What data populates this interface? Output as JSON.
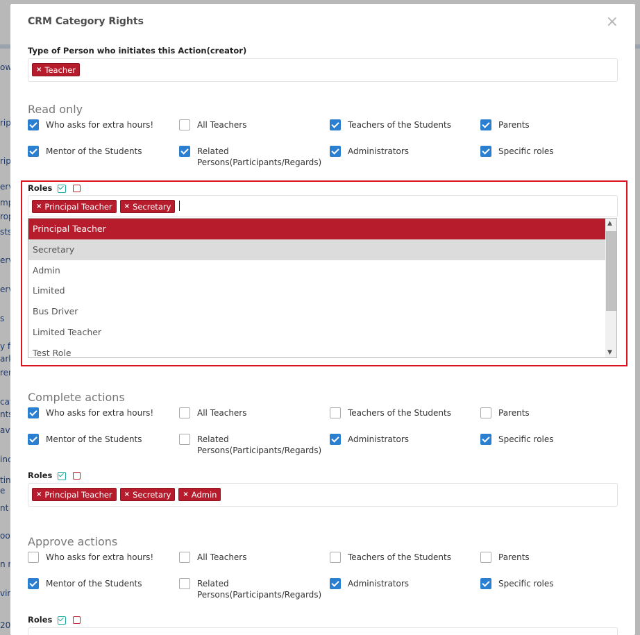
{
  "background": {
    "fragments": [
      "own",
      "rip",
      "ripi",
      "ervic",
      "mple",
      "ropo",
      "sts",
      "erv",
      "erv",
      "s",
      "y fr",
      "ark",
      "ren",
      "cat",
      "nts",
      "avio",
      "inci",
      "tin",
      "e",
      "nt",
      "ool",
      "n re",
      "ving",
      "20"
    ]
  },
  "modal": {
    "title": "CRM Category Rights",
    "close_glyph": "×",
    "creator_label": "Type of Person who initiates this Action(creator)",
    "creator_tags": [
      "Teacher"
    ]
  },
  "sections": [
    {
      "title": "Read only",
      "options": [
        {
          "label": "Who asks for extra hours!",
          "checked": true
        },
        {
          "label": "All Teachers",
          "checked": false
        },
        {
          "label": "Teachers of the Students",
          "checked": true
        },
        {
          "label": "Parents",
          "checked": true
        },
        {
          "label": "Mentor of the Students",
          "checked": true
        },
        {
          "label": "Related Persons(Participants/Regards)",
          "checked": true
        },
        {
          "label": "Administrators",
          "checked": true
        },
        {
          "label": "Specific roles",
          "checked": true
        }
      ],
      "roles_label": "Roles",
      "roles": [
        "Principal Teacher",
        "Secretary"
      ]
    },
    {
      "title": "Complete actions",
      "options": [
        {
          "label": "Who asks for extra hours!",
          "checked": true
        },
        {
          "label": "All Teachers",
          "checked": false
        },
        {
          "label": "Teachers of the Students",
          "checked": false
        },
        {
          "label": "Parents",
          "checked": false
        },
        {
          "label": "Mentor of the Students",
          "checked": true
        },
        {
          "label": "Related Persons(Participants/Regards)",
          "checked": false
        },
        {
          "label": "Administrators",
          "checked": true
        },
        {
          "label": "Specific roles",
          "checked": true
        }
      ],
      "roles_label": "Roles",
      "roles": [
        "Principal Teacher",
        "Secretary",
        "Admin"
      ]
    },
    {
      "title": "Approve actions",
      "options": [
        {
          "label": "Who asks for extra hours!",
          "checked": false
        },
        {
          "label": "All Teachers",
          "checked": false
        },
        {
          "label": "Teachers of the Students",
          "checked": false
        },
        {
          "label": "Parents",
          "checked": false
        },
        {
          "label": "Mentor of the Students",
          "checked": true
        },
        {
          "label": "Related Persons(Participants/Regards)",
          "checked": false
        },
        {
          "label": "Administrators",
          "checked": true
        },
        {
          "label": "Specific roles",
          "checked": true
        }
      ],
      "roles_label": "Roles",
      "roles": []
    }
  ],
  "dropdown": {
    "items": [
      "Principal Teacher",
      "Secretary",
      "Admin",
      "Limited",
      "Bus Driver",
      "Limited Teacher",
      "Test Role"
    ],
    "active_index": 0,
    "hover_index": 1
  },
  "colors": {
    "accent": "#b71c2c",
    "checkbox": "#2a7fd1",
    "highlight_border": "#d9141f",
    "select_all_icon": "#1aa99a"
  }
}
